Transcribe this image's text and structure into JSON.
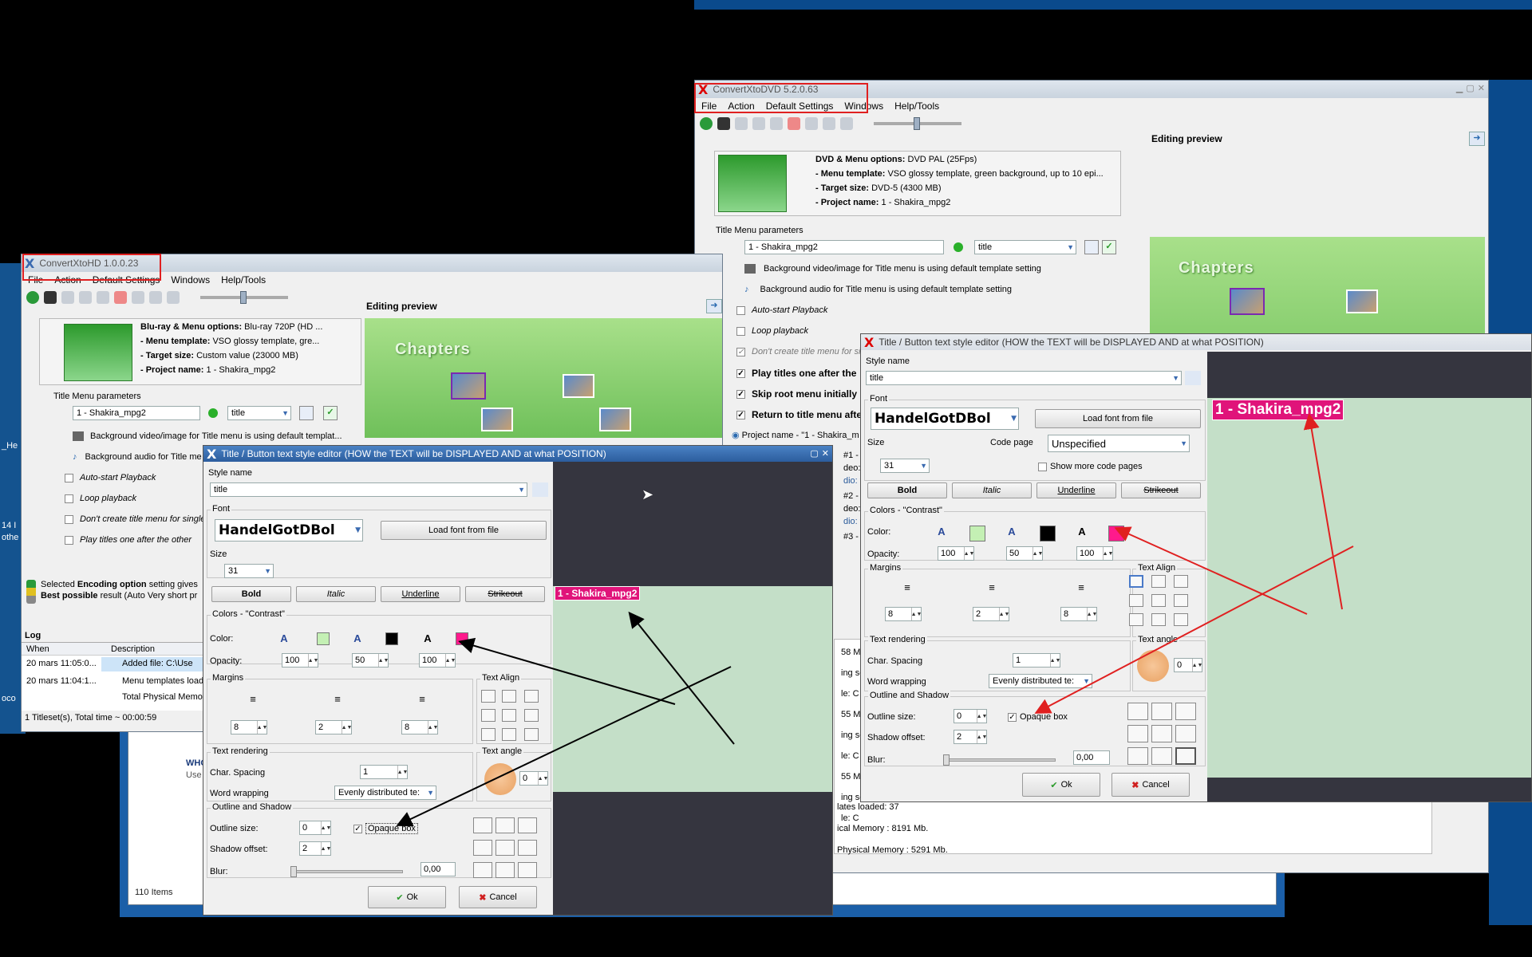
{
  "main_window": {
    "title": "ConvertXtoDVD 5.2.0.63",
    "menu": [
      "File",
      "Action",
      "Default Settings",
      "Windows",
      "Help/Tools"
    ],
    "dvd_options_label": "DVD & Menu options:",
    "dvd_options_value": "DVD PAL (25Fps)",
    "menu_template_label": "- Menu template:",
    "menu_template_value": "VSO glossy template, green background, up to 10 epi...",
    "target_size_label": "- Target size:",
    "target_size_value": "DVD-5 (4300 MB)",
    "project_name_label": "- Project name:",
    "project_name_value": "1 - Shakira_mpg2",
    "title_menu_params": "Title Menu parameters",
    "title_field": "1 - Shakira_mpg2",
    "style_select": "title",
    "bg_video": "Background video/image for Title menu is using default template setting",
    "bg_audio": "Background audio for Title menu is using default template setting",
    "opts": [
      "Auto-start Playback",
      "Loop playback",
      "Don't create title menu for si",
      "Play titles one after the",
      "Skip root menu initially",
      "Return to title menu afte"
    ],
    "project_row": "Project name - \"1 - Shakira_m",
    "preview_title": "Editing preview",
    "chapters": "Chapters",
    "log_tail": [
      "58 Mb",
      "ing ses",
      "le: C",
      "55 Mb.",
      "ing ses",
      "le: C",
      "55 Mb.",
      "ing ses",
      "le: C",
      "lates loaded: 37",
      "ical Memory : 8191 Mb.",
      "Physical Memory : 5291 Mb."
    ],
    "side_frags": [
      "#1 -",
      "deo: 4",
      "dio: y",
      "#2 -",
      "deo: 4",
      "dio: y",
      "#3 -"
    ]
  },
  "hd_window": {
    "title": "ConvertXtoHD 1.0.0.23",
    "menu": [
      "File",
      "Action",
      "Default Settings",
      "Windows",
      "Help/Tools"
    ],
    "options_label": "Blu-ray & Menu options:",
    "options_value": "Blu-ray 720P (HD ...",
    "menu_template_label": "- Menu template:",
    "menu_template_value": "VSO glossy template, gre...",
    "target_size_label": "- Target size:",
    "target_size_value": "Custom value (23000 MB)",
    "project_name_label": "- Project name:",
    "project_name_value": "1 - Shakira_mpg2",
    "title_menu_params": "Title Menu parameters",
    "title_field": "1 - Shakira_mpg2",
    "style_select": "title",
    "bg_video": "Background video/image for Title menu is using default templat...",
    "bg_audio": "Background audio for Title me",
    "opts": [
      "Auto-start Playback",
      "Loop playback",
      "Don't create title menu for single",
      "Play titles one after the other"
    ],
    "status1_a": "Selected ",
    "status1_b": "Encoding option",
    "status1_c": " setting gives",
    "status2_a": "Best possible",
    "status2_b": " result (Auto Very short pr",
    "preview_title": "Editing preview",
    "chapters": "Chapters",
    "log_title": "Log",
    "log_col_when": "When",
    "log_col_desc": "Description",
    "log_rows": [
      {
        "when": "20 mars 11:05:0...",
        "desc": "Added file: C:\\Use"
      },
      {
        "when": "20 mars 11:04:1...",
        "desc": "Menu templates load"
      },
      {
        "when": "",
        "desc": "Total Physical Memor"
      }
    ],
    "footer": "1 Titleset(s), Total time ~ 00:00:59"
  },
  "explorer": {
    "items": "110 Items",
    "frag_who": "WHO",
    "frag_use": "Use"
  },
  "desktop": {
    "frags": [
      "_He",
      "14 I",
      "othe",
      "oco"
    ]
  },
  "editor_left": {
    "title": "Title / Button text style editor   (HOW the TEXT will be DISPLAYED AND at what POSITION)",
    "style_name_label": "Style name",
    "style_name": "title",
    "font_label": "Font",
    "font_name": "HandelGotDBol",
    "load_font": "Load font from file",
    "size_label": "Size",
    "size": "31",
    "bold": "Bold",
    "italic": "Italic",
    "underline": "Underline",
    "strikeout": "Strikeout",
    "colors_label": "Colors - \"Contrast\"",
    "color_label": "Color:",
    "opacity_label": "Opacity:",
    "opacity": [
      "100",
      "50",
      "100"
    ],
    "margins_label": "Margins",
    "margins": [
      "8",
      "2",
      "8"
    ],
    "text_align_label": "Text Align",
    "rendering_label": "Text rendering",
    "char_spacing_label": "Char. Spacing",
    "char_spacing": "1",
    "word_wrap_label": "Word wrapping",
    "word_wrap": "Evenly distributed te:",
    "angle_label": "Text angle",
    "angle": "0",
    "outline_label": "Outline  and Shadow",
    "outline_size_label": "Outline size:",
    "outline_size": "0",
    "opaque_box": "Opaque box",
    "shadow_offset_label": "Shadow offset:",
    "shadow_offset": "2",
    "blur_label": "Blur:",
    "blur": "0,00",
    "ok": "Ok",
    "cancel": "Cancel",
    "preview_text": "1 - Shakira_mpg2"
  },
  "editor_right": {
    "title": "Title / Button text style editor   (HOW the TEXT will be DISPLAYED AND at what POSITION)",
    "style_name_label": "Style name",
    "style_name": "title",
    "font_label": "Font",
    "font_name": "HandelGotDBol",
    "load_font": "Load font from file",
    "size_label": "Size",
    "size": "31",
    "code_page_label": "Code page",
    "code_page": "Unspecified",
    "more_code_pages": "Show more code pages",
    "bold": "Bold",
    "italic": "Italic",
    "underline": "Underline",
    "strikeout": "Strikeout",
    "colors_label": "Colors - \"Contrast\"",
    "color_label": "Color:",
    "opacity_label": "Opacity:",
    "opacity": [
      "100",
      "50",
      "100"
    ],
    "margins_label": "Margins",
    "margins": [
      "8",
      "2",
      "8"
    ],
    "text_align_label": "Text Align",
    "rendering_label": "Text rendering",
    "char_spacing_label": "Char. Spacing",
    "char_spacing": "1",
    "word_wrap_label": "Word wrapping",
    "word_wrap": "Evenly distributed te:",
    "angle_label": "Text angle",
    "angle": "0",
    "outline_label": "Outline  and Shadow",
    "outline_size_label": "Outline size:",
    "outline_size": "0",
    "opaque_box": "Opaque box",
    "shadow_offset_label": "Shadow offset:",
    "shadow_offset": "2",
    "blur_label": "Blur:",
    "blur": "0,00",
    "ok": "Ok",
    "cancel": "Cancel",
    "preview_text": "1 - Shakira_mpg2"
  },
  "colors": {
    "swatch_green": "#c4f0b4",
    "swatch_black": "#000000",
    "swatch_pink": "#ff1a8c",
    "annotation": "#e02020"
  }
}
